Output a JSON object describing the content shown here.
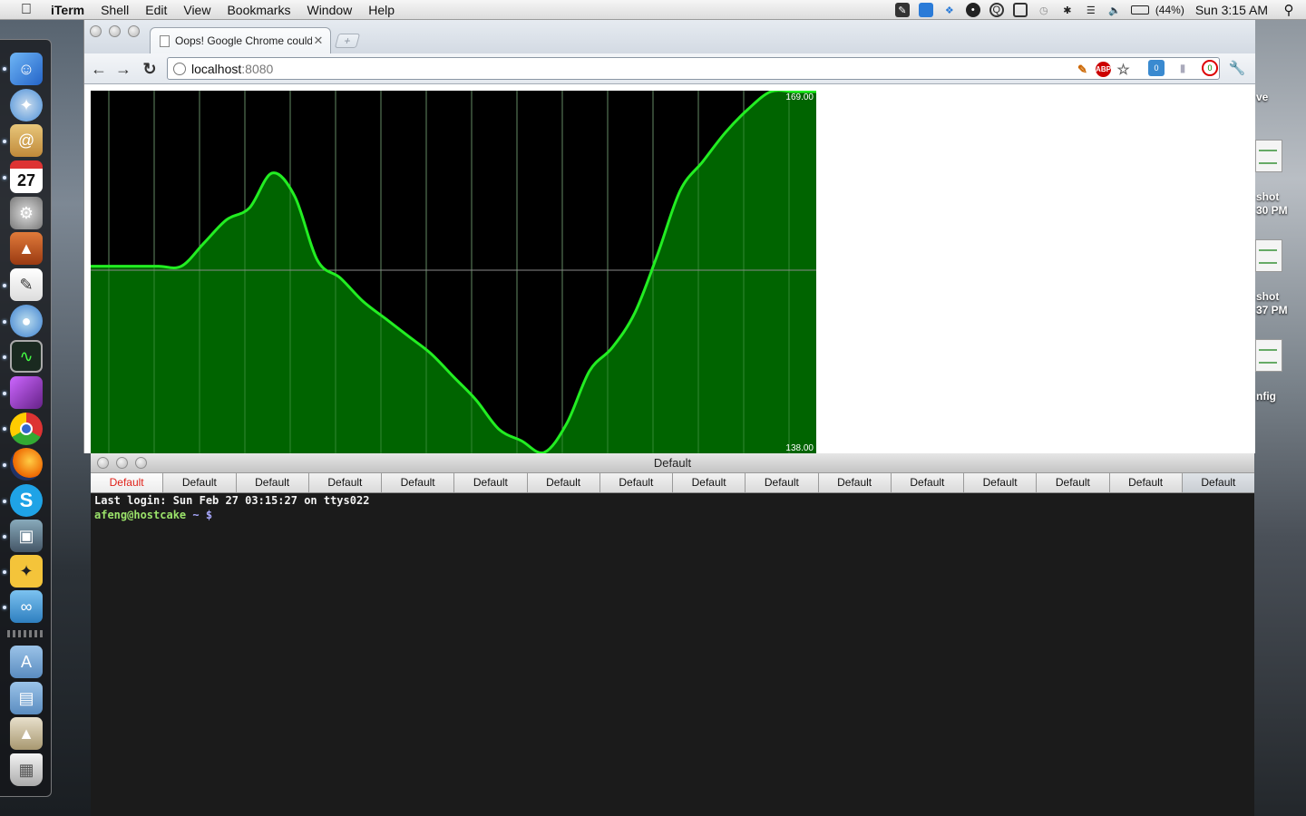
{
  "menubar": {
    "app_name": "iTerm",
    "items": [
      "Shell",
      "Edit",
      "View",
      "Bookmarks",
      "Window",
      "Help"
    ],
    "battery_percent": "(44%)",
    "clock": "Sun 3:15 AM"
  },
  "desktop": {
    "labels": [
      "ve",
      "shot",
      "30 PM",
      "shot",
      "37 PM",
      "nfig"
    ]
  },
  "dock": {
    "apps": [
      "finder-icon",
      "safari-icon",
      "mail-icon",
      "ical-icon",
      "system-preferences-icon",
      "keynote-icon",
      "textedit-icon",
      "ichat-icon",
      "activity-monitor-icon",
      "purple-app-icon",
      "chrome-icon",
      "firefox-icon",
      "skype-icon",
      "iphoto-icon",
      "twitter-bird-icon",
      "network-utility-icon"
    ],
    "ical_date": "27",
    "folders": [
      "applications-folder-icon",
      "documents-folder-icon",
      "downloads-stack-icon",
      "trash-icon"
    ]
  },
  "chrome": {
    "tab_title": "Oops! Google Chrome could",
    "url_host": "localhost",
    "url_port": ":8080",
    "abp_label": "ABP",
    "ext_badges": [
      "0",
      "0"
    ]
  },
  "chart_data": {
    "type": "area",
    "title": "",
    "xlabel": "",
    "ylabel": "",
    "ylim": [
      138.0,
      169.0
    ],
    "y_max_label": "169.00",
    "y_min_label": "138.00",
    "gridlines_x": 16,
    "gridline_y_mid": true,
    "colors": {
      "background": "#000000",
      "line": "#22ee22",
      "fill": "#006400",
      "grid": "#6b6b6b"
    },
    "x": [
      0,
      5,
      10,
      15,
      20,
      25,
      30,
      35,
      40,
      45,
      50,
      55,
      60,
      65,
      70,
      75,
      80,
      85,
      90,
      95,
      100,
      105,
      110,
      115,
      120,
      125,
      130,
      135,
      140,
      145,
      150,
      155,
      160
    ],
    "values": [
      154.0,
      154.0,
      154.0,
      154.0,
      154.0,
      156.0,
      158.0,
      159.0,
      162.0,
      160.0,
      154.5,
      153.0,
      151.0,
      149.5,
      148.0,
      146.5,
      144.5,
      142.5,
      140.0,
      139.0,
      138.0,
      140.5,
      145.0,
      147.0,
      150.0,
      155.0,
      160.5,
      163.0,
      165.5,
      167.5,
      169.0,
      169.0,
      169.0
    ]
  },
  "iterm": {
    "window_title": "Default",
    "tabs": [
      "Default",
      "Default",
      "Default",
      "Default",
      "Default",
      "Default",
      "Default",
      "Default",
      "Default",
      "Default",
      "Default",
      "Default",
      "Default",
      "Default",
      "Default",
      "Default"
    ],
    "last_login": "Last login: Sun Feb 27 03:15:27 on ttys022",
    "prompt_user": "afeng@hostcake",
    "prompt_path": " ~ ",
    "prompt_symbol": "$"
  }
}
